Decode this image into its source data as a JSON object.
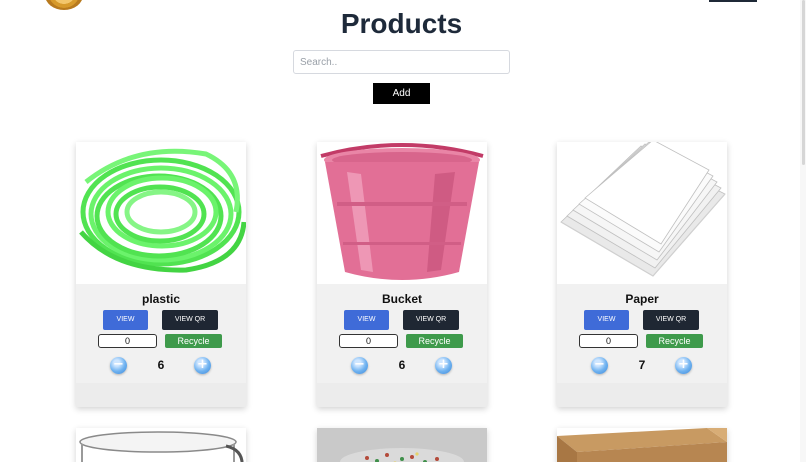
{
  "header": {
    "title": "Products"
  },
  "search": {
    "placeholder": "Search.."
  },
  "actions": {
    "add_label": "Add"
  },
  "products": [
    {
      "name": "plastic",
      "view_label": "VIEW",
      "qr_label": "VIEW QR",
      "quantity": "0",
      "recycle_label": "Recycle",
      "count": "6"
    },
    {
      "name": "Bucket",
      "view_label": "VIEW",
      "qr_label": "VIEW QR",
      "quantity": "0",
      "recycle_label": "Recycle",
      "count": "6"
    },
    {
      "name": "Paper",
      "view_label": "VIEW",
      "qr_label": "VIEW QR",
      "quantity": "0",
      "recycle_label": "Recycle",
      "count": "7"
    }
  ],
  "icons": {
    "minus": "minus-icon",
    "plus": "plus-icon"
  },
  "colors": {
    "view_button": "#3f6bd8",
    "qr_button": "#1f2733",
    "recycle_button": "#3e9a4b",
    "add_button": "#000000",
    "title": "#1e2a3a"
  }
}
